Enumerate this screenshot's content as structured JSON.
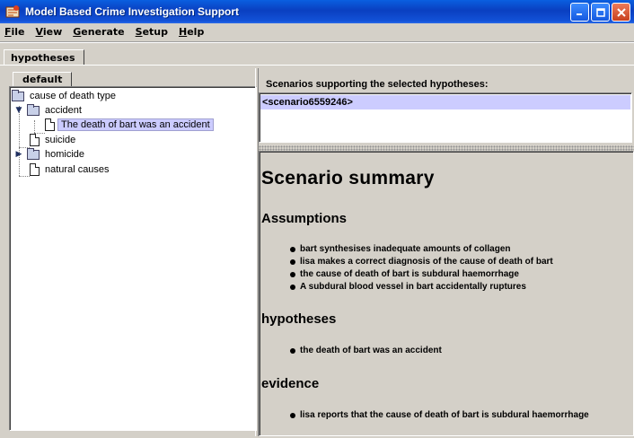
{
  "window": {
    "title": "Model Based Crime Investigation Support",
    "controls": [
      "minimize",
      "maximize",
      "close"
    ]
  },
  "menu": [
    {
      "mnemonic": "F",
      "rest": "ile"
    },
    {
      "mnemonic": "V",
      "rest": "iew"
    },
    {
      "mnemonic": "G",
      "rest": "enerate"
    },
    {
      "mnemonic": "S",
      "rest": "etup"
    },
    {
      "mnemonic": "H",
      "rest": "elp"
    }
  ],
  "tabs": {
    "outer": "hypotheses",
    "inner": "default"
  },
  "tree": {
    "root": "cause of death type",
    "accident": "accident",
    "accident_child": "The death of bart was an accident",
    "suicide": "suicide",
    "homicide": "homicide",
    "natural": "natural causes"
  },
  "scenarios": {
    "header": "Scenarios supporting the selected hypotheses:",
    "items": [
      "<scenario6559246>"
    ]
  },
  "summary": {
    "title": "Scenario summary",
    "assumptions_heading": "Assumptions",
    "assumptions": [
      "bart synthesises inadequate amounts of collagen",
      "lisa makes a correct diagnosis of the cause of death of bart",
      "the cause of death of bart is subdural haemorrhage",
      "A subdural blood vessel in bart accidentally ruptures"
    ],
    "hypotheses_heading": "hypotheses",
    "hypotheses": [
      "the death of bart was an accident"
    ],
    "evidence_heading": "evidence",
    "evidence": [
      "lisa reports that the cause of death of bart is subdural haemorrhage"
    ]
  },
  "colors": {
    "title_bar": "#0a4fd8",
    "selection": "#ccccff",
    "window_bg": "#d4d0c8"
  }
}
